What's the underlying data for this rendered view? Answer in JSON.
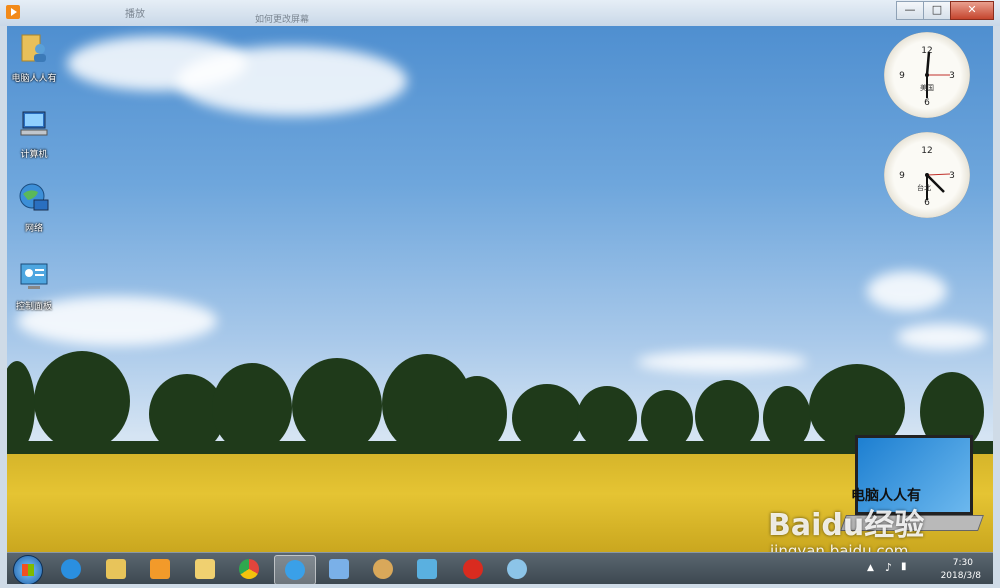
{
  "window": {
    "title": "播放",
    "subtitle": "如何更改屏幕",
    "minimize_label": "—",
    "maximize_label": "□",
    "close_label": "✕"
  },
  "desktop_icons": [
    {
      "label": "电脑人人有",
      "icon": "user-folder-icon"
    },
    {
      "label": "计算机",
      "icon": "computer-icon"
    },
    {
      "label": "网络",
      "icon": "network-icon"
    },
    {
      "label": "控制面板",
      "icon": "control-panel-icon"
    }
  ],
  "gadgets": {
    "clock1_label": "美国",
    "clock2_label": "台北"
  },
  "laptop_widget_text": "电脑人人有",
  "watermark": {
    "line1": "Baidu经验",
    "line2": "jingyan.baidu.com"
  },
  "taskbar": {
    "items": [
      {
        "icon": "ie-icon",
        "color": "#2a8fe0"
      },
      {
        "icon": "explorer-folder-icon",
        "color": "#e8c45a"
      },
      {
        "icon": "media-player-icon",
        "color": "#f29a2a"
      },
      {
        "icon": "folder-icon",
        "color": "#f0d070"
      },
      {
        "icon": "chrome-icon",
        "color": "#e2453c"
      },
      {
        "icon": "browser-icon",
        "color": "#3aa0e8"
      },
      {
        "icon": "document-icon",
        "color": "#7ab0e8"
      },
      {
        "icon": "paint-icon",
        "color": "#d9a85a"
      },
      {
        "icon": "remote-desktop-icon",
        "color": "#5ab0e0"
      },
      {
        "icon": "chess-icon",
        "color": "#d92b1f"
      },
      {
        "icon": "settings-app-icon",
        "color": "#8cc4e8"
      }
    ],
    "time": "7:30",
    "date": "2018/3/8"
  },
  "colors": {
    "sky_top": "#4f8fd0",
    "field": "#d6b52a",
    "taskbar": "#3c4750"
  }
}
